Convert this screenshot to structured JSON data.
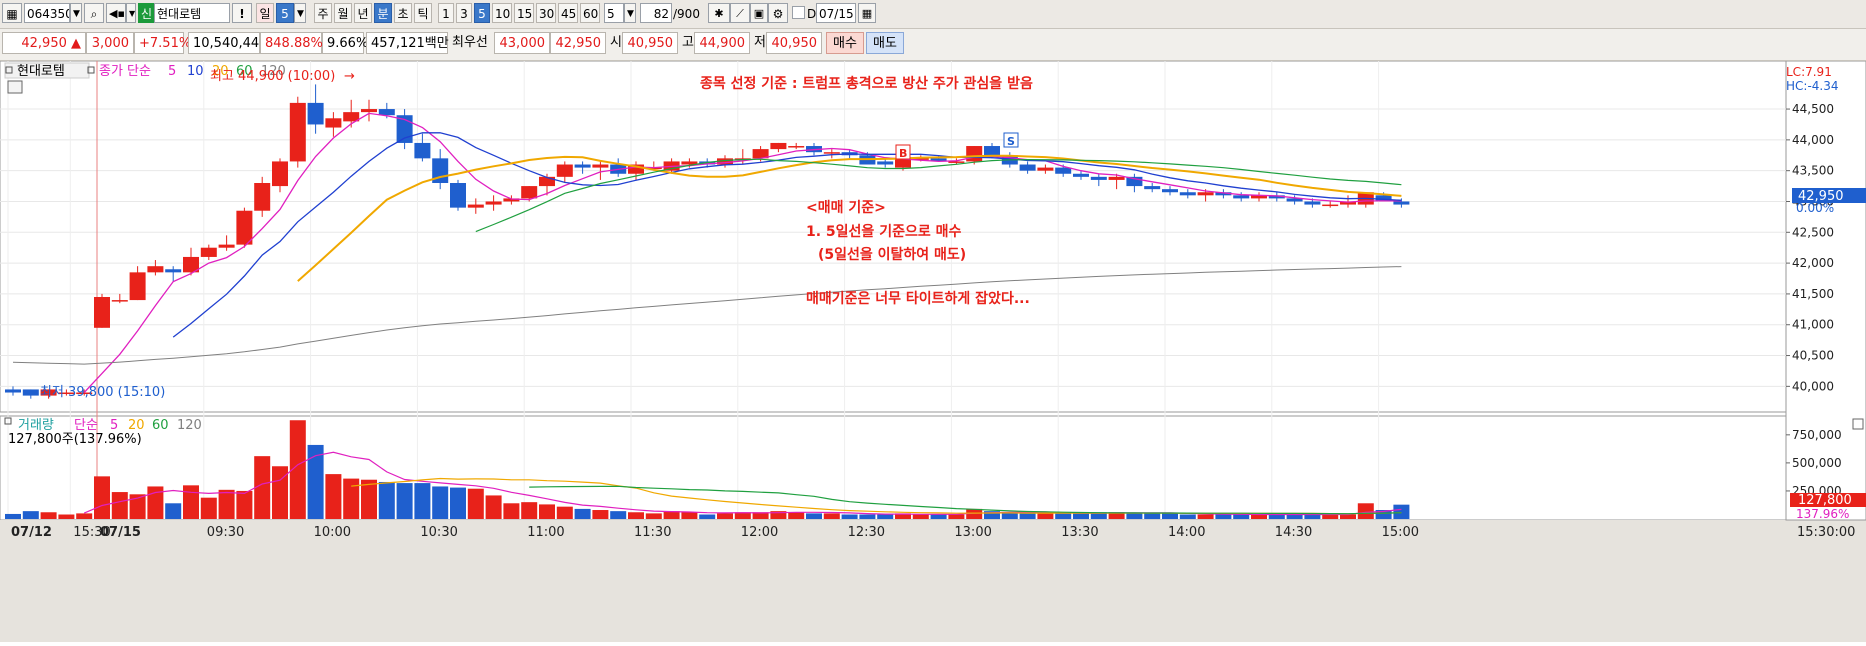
{
  "toolbar": {
    "code": "064350",
    "name_badge": "신",
    "name": "현대로템",
    "excl": "!",
    "period_day": "일",
    "period_num": "5",
    "periods": [
      "주",
      "월",
      "년",
      "분",
      "초",
      "틱"
    ],
    "minutes": [
      "1",
      "3",
      "5",
      "10",
      "15",
      "30",
      "45",
      "60"
    ],
    "minute_input": "5",
    "count": "82",
    "count_total": "/900",
    "d_label": "D",
    "date": "07/15"
  },
  "info": {
    "price": "42,950 ▲",
    "change": "3,000",
    "rate": "+7.51%",
    "volume": "10,540,448",
    "vol_ratio": "848.88%",
    "turnover": "9.66%",
    "amount": "457,121백만",
    "best_label": "최우선",
    "best_ask": "43,000",
    "best_bid": "42,950",
    "open_label": "시",
    "open": "40,950",
    "high_label": "고",
    "high": "44,900",
    "low_label": "저",
    "low": "40,950",
    "buy": "매수",
    "sell": "매도"
  },
  "legend": {
    "name": "현대로템",
    "ma_label": "종가 단순",
    "ma": [
      "5",
      "10",
      "20",
      "60",
      "120"
    ],
    "vol_label": "거래량",
    "vol_ma_label": "단순",
    "vol_value": "127,800주(137.96%)"
  },
  "annotations": {
    "high": "최고 44,900 (10:00)",
    "low": "최저 39,800 (15:10)",
    "criteria_title": "종목 선정 기준 : 트럼프 총격으로 방산 주가 관심을 받음",
    "rule_title": "<매매 기준>",
    "rule1": "1. 5일선을 기준으로 매수",
    "rule2": "(5일선을 이탈하여 매도)",
    "note": "매매기준은 너무 타이트하게 잡았다...",
    "b_marker": "B",
    "s_marker": "S",
    "lc": "LC:7.91",
    "hc": "HC:-4.34",
    "cur_price": "42,950",
    "cur_pct": "0.00%",
    "cur_vol": "127,800",
    "cur_vol_pct": "137.96%"
  },
  "colors": {
    "up": "#e8221a",
    "down": "#1f5fce",
    "ma5": "#e020c0",
    "ma10": "#2040d0",
    "ma20": "#f0a800",
    "ma60": "#20a040",
    "ma120": "#808080",
    "annotation": "#e8221a"
  },
  "chart_data": {
    "type": "candlestick",
    "interval": "5min",
    "price_axis_ticks": [
      "44,500",
      "44,000",
      "43,500",
      "43,000",
      "42,500",
      "42,000",
      "41,500",
      "41,000",
      "40,500",
      "40,000"
    ],
    "price_ylim": [
      39600,
      45150
    ],
    "volume_axis_ticks": [
      "750,000",
      "500,000",
      "250,000"
    ],
    "volume_ylim": [
      0,
      900000
    ],
    "time_ticks": [
      "07/12",
      "15:30",
      "07/15",
      "09:30",
      "10:00",
      "10:30",
      "11:00",
      "11:30",
      "12:00",
      "12:30",
      "13:00",
      "13:30",
      "14:00",
      "14:30",
      "15:00",
      "15:30:00"
    ],
    "ohlcv": [
      [
        39950,
        40000,
        39850,
        39900,
        45000
      ],
      [
        39950,
        39950,
        39800,
        39850,
        70000
      ],
      [
        39850,
        39950,
        39800,
        39950,
        60000
      ],
      [
        39900,
        39950,
        39850,
        39900,
        40000
      ],
      [
        39900,
        39950,
        39850,
        39900,
        50000
      ],
      [
        40950,
        41500,
        40950,
        41450,
        380000
      ],
      [
        41400,
        41500,
        41350,
        41400,
        240000
      ],
      [
        41400,
        41950,
        41400,
        41850,
        220000
      ],
      [
        41850,
        42050,
        41800,
        41950,
        290000
      ],
      [
        41900,
        41950,
        41700,
        41850,
        140000
      ],
      [
        41850,
        42250,
        41800,
        42100,
        300000
      ],
      [
        42100,
        42300,
        42050,
        42250,
        190000
      ],
      [
        42250,
        42450,
        42200,
        42300,
        260000
      ],
      [
        42300,
        42900,
        42250,
        42850,
        250000
      ],
      [
        42850,
        43400,
        42750,
        43300,
        560000
      ],
      [
        43250,
        43700,
        43150,
        43650,
        470000
      ],
      [
        43650,
        44700,
        43550,
        44600,
        880000
      ],
      [
        44600,
        44900,
        44100,
        44250,
        660000
      ],
      [
        44200,
        44450,
        44050,
        44350,
        400000
      ],
      [
        44300,
        44650,
        44200,
        44450,
        360000
      ],
      [
        44450,
        44650,
        44300,
        44500,
        350000
      ],
      [
        44500,
        44600,
        44350,
        44400,
        330000
      ],
      [
        44400,
        44500,
        43850,
        43950,
        320000
      ],
      [
        43950,
        44100,
        43650,
        43700,
        320000
      ],
      [
        43700,
        43850,
        43200,
        43300,
        290000
      ],
      [
        43300,
        43350,
        42850,
        42900,
        280000
      ],
      [
        42900,
        43050,
        42800,
        42950,
        270000
      ],
      [
        42950,
        43100,
        42850,
        43000,
        210000
      ],
      [
        43000,
        43100,
        42950,
        43050,
        140000
      ],
      [
        43050,
        43250,
        43000,
        43250,
        150000
      ],
      [
        43250,
        43450,
        43100,
        43400,
        130000
      ],
      [
        43400,
        43650,
        43300,
        43600,
        110000
      ],
      [
        43600,
        43650,
        43450,
        43550,
        90000
      ],
      [
        43550,
        43650,
        43350,
        43600,
        80000
      ],
      [
        43600,
        43700,
        43400,
        43450,
        70000
      ],
      [
        43450,
        43650,
        43350,
        43600,
        60000
      ],
      [
        43550,
        43650,
        43500,
        43550,
        50000
      ],
      [
        43500,
        43700,
        43450,
        43650,
        70000
      ],
      [
        43600,
        43700,
        43550,
        43650,
        60000
      ],
      [
        43650,
        43700,
        43550,
        43600,
        40000
      ],
      [
        43600,
        43750,
        43550,
        43700,
        50000
      ],
      [
        43700,
        43850,
        43600,
        43700,
        60000
      ],
      [
        43700,
        43900,
        43650,
        43850,
        60000
      ],
      [
        43850,
        43950,
        43800,
        43950,
        70000
      ],
      [
        43900,
        43950,
        43850,
        43900,
        60000
      ],
      [
        43900,
        43950,
        43750,
        43800,
        50000
      ],
      [
        43800,
        43850,
        43700,
        43800,
        50000
      ],
      [
        43800,
        43850,
        43700,
        43750,
        40000
      ],
      [
        43750,
        43800,
        43600,
        43600,
        40000
      ],
      [
        43650,
        43700,
        43550,
        43600,
        40000
      ],
      [
        43550,
        43750,
        43500,
        43700,
        50000
      ],
      [
        43700,
        43750,
        43650,
        43700,
        40000
      ],
      [
        43700,
        43750,
        43650,
        43650,
        40000
      ],
      [
        43650,
        43700,
        43600,
        43650,
        40000
      ],
      [
        43650,
        43900,
        43600,
        43900,
        90000
      ],
      [
        43900,
        43950,
        43700,
        43750,
        70000
      ],
      [
        43750,
        43800,
        43550,
        43600,
        60000
      ],
      [
        43600,
        43650,
        43450,
        43500,
        50000
      ],
      [
        43500,
        43600,
        43450,
        43550,
        50000
      ],
      [
        43550,
        43600,
        43400,
        43450,
        50000
      ],
      [
        43450,
        43500,
        43350,
        43400,
        50000
      ],
      [
        43400,
        43450,
        43250,
        43350,
        60000
      ],
      [
        43350,
        43450,
        43200,
        43400,
        60000
      ],
      [
        43400,
        43450,
        43150,
        43250,
        50000
      ],
      [
        43250,
        43300,
        43150,
        43200,
        50000
      ],
      [
        43200,
        43250,
        43100,
        43150,
        50000
      ],
      [
        43150,
        43200,
        43050,
        43100,
        40000
      ],
      [
        43100,
        43200,
        43000,
        43150,
        40000
      ],
      [
        43150,
        43200,
        43050,
        43100,
        40000
      ],
      [
        43100,
        43150,
        43000,
        43050,
        40000
      ],
      [
        43050,
        43150,
        43000,
        43100,
        40000
      ],
      [
        43100,
        43150,
        43000,
        43050,
        40000
      ],
      [
        43050,
        43100,
        42950,
        43000,
        40000
      ],
      [
        43000,
        43050,
        42900,
        42950,
        40000
      ],
      [
        42950,
        43000,
        42900,
        42950,
        40000
      ],
      [
        42950,
        43100,
        42900,
        43000,
        40000
      ],
      [
        42950,
        43150,
        42900,
        43150,
        140000
      ],
      [
        43100,
        43150,
        43000,
        43000,
        80000
      ],
      [
        43000,
        43050,
        42900,
        42950,
        127800
      ]
    ]
  }
}
